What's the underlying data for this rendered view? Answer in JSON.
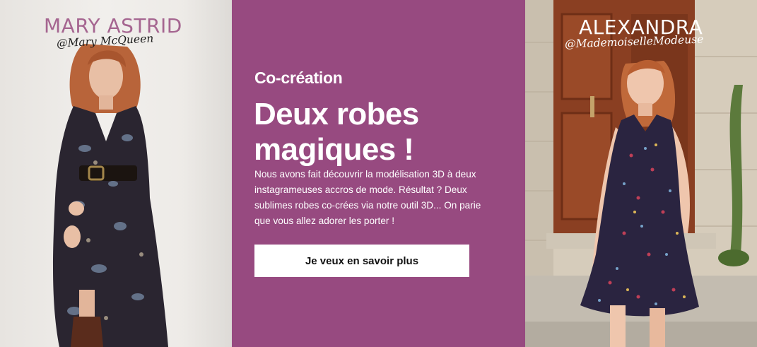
{
  "left_influencer": {
    "name": "MARY ASTRID",
    "handle": "@Mary McQueen"
  },
  "promo": {
    "eyebrow": "Co-création",
    "headline": "Deux robes magiques !",
    "body": "Nous avons fait découvrir la modélisation 3D à deux instagrameuses accros de mode. Résultat ? Deux sublimes robes co-crées via notre outil 3D... On parie que vous allez adorer les porter !",
    "cta_label": "Je veux en savoir plus"
  },
  "right_influencer": {
    "name": "ALEXANDRA",
    "handle": "@MademoiselleModeuse"
  },
  "colors": {
    "promo_background": "#974a80",
    "left_name": "#a56590",
    "cta_background": "#ffffff"
  }
}
